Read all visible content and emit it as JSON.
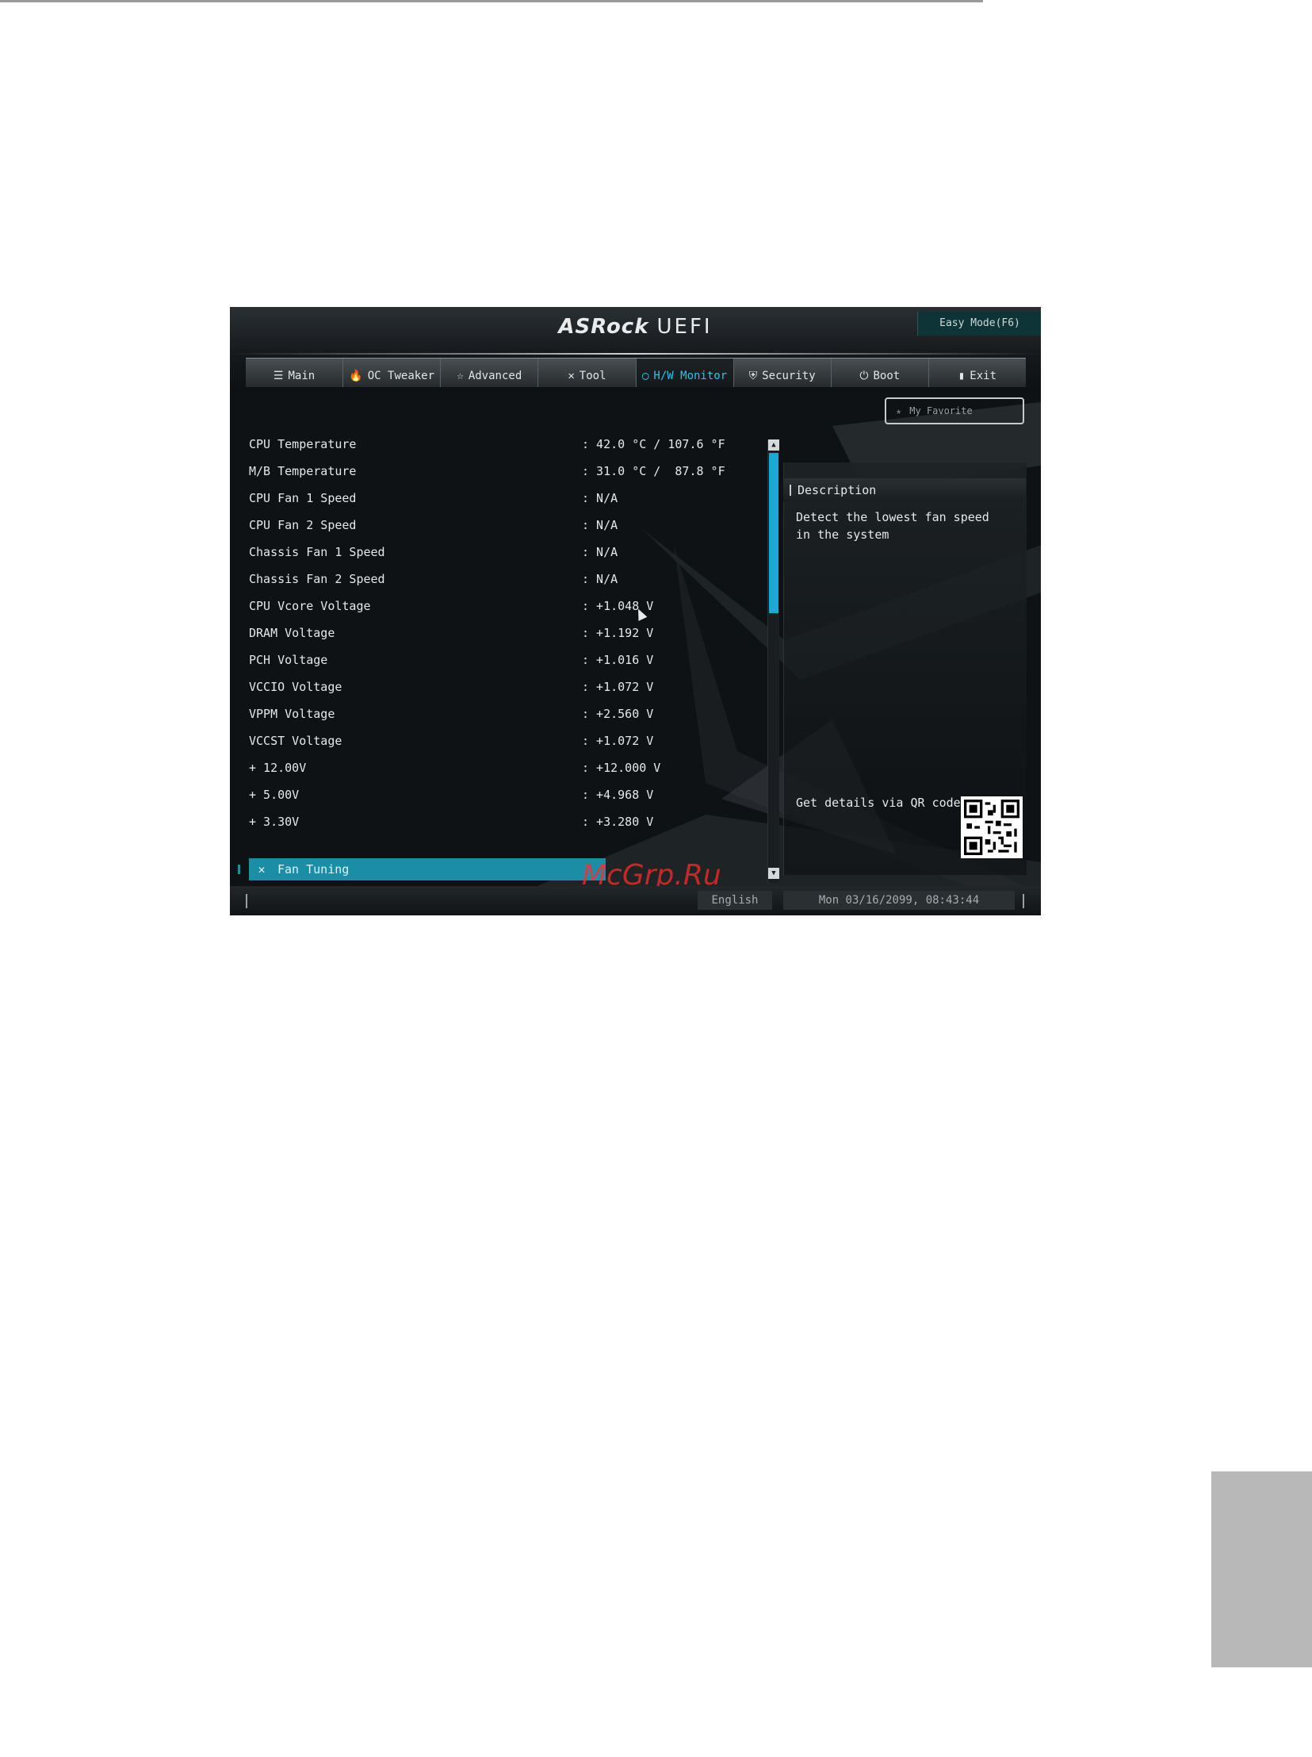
{
  "header": {
    "logo_brand": "ASRock",
    "logo_product": "UEFI",
    "easy_mode": "Easy Mode(F6)"
  },
  "tabs": [
    {
      "label": "Main",
      "icon": "list-icon",
      "glyph": "☰",
      "active": false
    },
    {
      "label": "OC Tweaker",
      "icon": "rocket-icon",
      "glyph": "🔥",
      "active": false
    },
    {
      "label": "Advanced",
      "icon": "star-icon",
      "glyph": "☆",
      "active": false
    },
    {
      "label": "Tool",
      "icon": "tools-icon",
      "glyph": "✕",
      "active": false
    },
    {
      "label": "H/W Monitor",
      "icon": "monitor-icon",
      "glyph": "◯",
      "active": true
    },
    {
      "label": "Security",
      "icon": "shield-icon",
      "glyph": "⛨",
      "active": false
    },
    {
      "label": "Boot",
      "icon": "power-icon",
      "glyph": "⏻",
      "active": false
    },
    {
      "label": "Exit",
      "icon": "exit-icon",
      "glyph": "▮",
      "active": false
    }
  ],
  "favorite": {
    "label": "My Favorite"
  },
  "readings": [
    {
      "label": "CPU Temperature",
      "value": ": 42.0 °C / 107.6 °F"
    },
    {
      "label": "M/B Temperature",
      "value": ": 31.0 °C /  87.8 °F"
    },
    {
      "label": "CPU Fan 1 Speed",
      "value": ": N/A"
    },
    {
      "label": "CPU Fan 2 Speed",
      "value": ": N/A"
    },
    {
      "label": "Chassis Fan 1 Speed",
      "value": ": N/A"
    },
    {
      "label": "Chassis Fan 2 Speed",
      "value": ": N/A"
    },
    {
      "label": "CPU Vcore Voltage",
      "value": ": +1.048 V"
    },
    {
      "label": "DRAM Voltage",
      "value": ": +1.192 V"
    },
    {
      "label": "PCH Voltage",
      "value": ": +1.016 V"
    },
    {
      "label": "VCCIO Voltage",
      "value": ": +1.072 V"
    },
    {
      "label": "VPPM Voltage",
      "value": ": +2.560 V"
    },
    {
      "label": "VCCST Voltage",
      "value": ": +1.072 V"
    },
    {
      "label": "+ 12.00V",
      "value": ": +12.000 V"
    },
    {
      "label": "+ 5.00V",
      "value": ": +4.968 V"
    },
    {
      "label": "+ 3.30V",
      "value": ": +3.280 V"
    }
  ],
  "fan_tuning": {
    "label": "Fan Tuning"
  },
  "watermark": "McGrp.Ru",
  "description": {
    "title": "Description",
    "text": "Detect the lowest fan speed in the system",
    "qr_label": "Get details via QR code"
  },
  "footer": {
    "language": "English",
    "datetime": "Mon 03/16/2099, 08:43:44"
  },
  "colors": {
    "accent": "#1ba8d2",
    "selection": "#1b8ea6",
    "watermark": "#ff2a2a"
  }
}
